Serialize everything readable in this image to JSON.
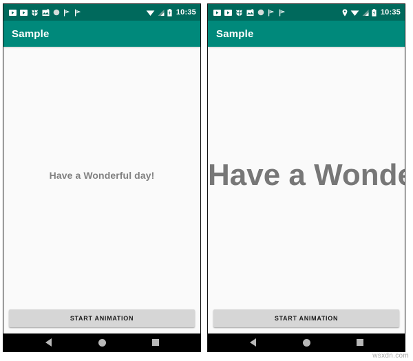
{
  "watermark": "wsxdn.com",
  "colors": {
    "status_bar": "#00695c",
    "app_bar": "#00897b",
    "app_bar_title": "#ffffff",
    "content_bg": "#fafafa",
    "message_text": "#818181",
    "button_bg": "#d6d6d6",
    "button_text": "#1b1b1b",
    "nav_bar": "#000000",
    "nav_icon": "#b8b8b8"
  },
  "panels": [
    {
      "id": "before-animation",
      "status_bar": {
        "left_icons": [
          "video-player-icon",
          "video-player-icon",
          "android-bug-icon",
          "broken-image-icon",
          "circle-icon",
          "play-store-flag-icon",
          "play-store-icon"
        ],
        "right_icons": [
          "wifi-icon",
          "cellular-signal-icon",
          "battery-icon"
        ],
        "clock": "10:35"
      },
      "app_bar": {
        "title": "Sample"
      },
      "content": {
        "message": "Have a Wonderful day!",
        "message_scale": "normal"
      },
      "button": {
        "label": "START ANIMATION"
      },
      "nav_bar": {
        "back": "back-icon",
        "home": "home-icon",
        "recents": "recents-icon"
      }
    },
    {
      "id": "after-animation",
      "status_bar": {
        "left_icons": [
          "video-player-icon",
          "video-player-icon",
          "android-bug-icon",
          "broken-image-icon",
          "circle-icon",
          "play-store-flag-icon",
          "play-store-icon"
        ],
        "right_icons": [
          "location-pin-icon",
          "wifi-icon",
          "cellular-signal-icon",
          "battery-icon"
        ],
        "clock": "10:35"
      },
      "app_bar": {
        "title": "Sample"
      },
      "content": {
        "message": "Have a Wonderful day!",
        "message_scale": "zoomed"
      },
      "button": {
        "label": "START ANIMATION"
      },
      "nav_bar": {
        "back": "back-icon",
        "home": "home-icon",
        "recents": "recents-icon"
      }
    }
  ]
}
